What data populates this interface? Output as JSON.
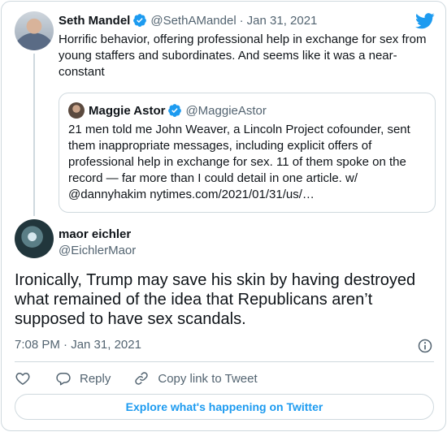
{
  "parent_tweet": {
    "author_name": "Seth Mandel",
    "author_handle": "@SethAMandel",
    "separator": "·",
    "date": "Jan 31, 2021",
    "text": "Horrific behavior, offering professional help in exchange for sex from young staffers and subordinates. And seems like it was a near-constant"
  },
  "quoted_tweet": {
    "author_name": "Maggie Astor",
    "author_handle": "@MaggieAstor",
    "text": "21 men told me John Weaver, a Lincoln Project cofounder, sent them inappropriate messages, including explicit offers of professional help in exchange for sex. 11 of them spoke on the record — far more than I could detail in one article. w/ @dannyhakim  nytimes.com/2021/01/31/us/…"
  },
  "main_tweet": {
    "author_name": "maor eichler",
    "author_handle": "@EichlerMaor",
    "text": "Ironically, Trump may save his skin by having destroyed what remained of the idea that Republicans aren’t supposed to have sex scandals.",
    "timestamp": "7:08 PM · Jan 31, 2021"
  },
  "actions": {
    "reply_label": "Reply",
    "copy_link_label": "Copy link to Tweet"
  },
  "explore_label": "Explore what's happening on Twitter",
  "colors": {
    "accent": "#1d9bf0",
    "text": "#0f1419",
    "muted": "#536471",
    "border": "#cfd9de"
  },
  "icons": [
    "verified-badge-icon",
    "twitter-bird-icon",
    "info-icon",
    "heart-icon",
    "reply-icon",
    "link-icon"
  ]
}
